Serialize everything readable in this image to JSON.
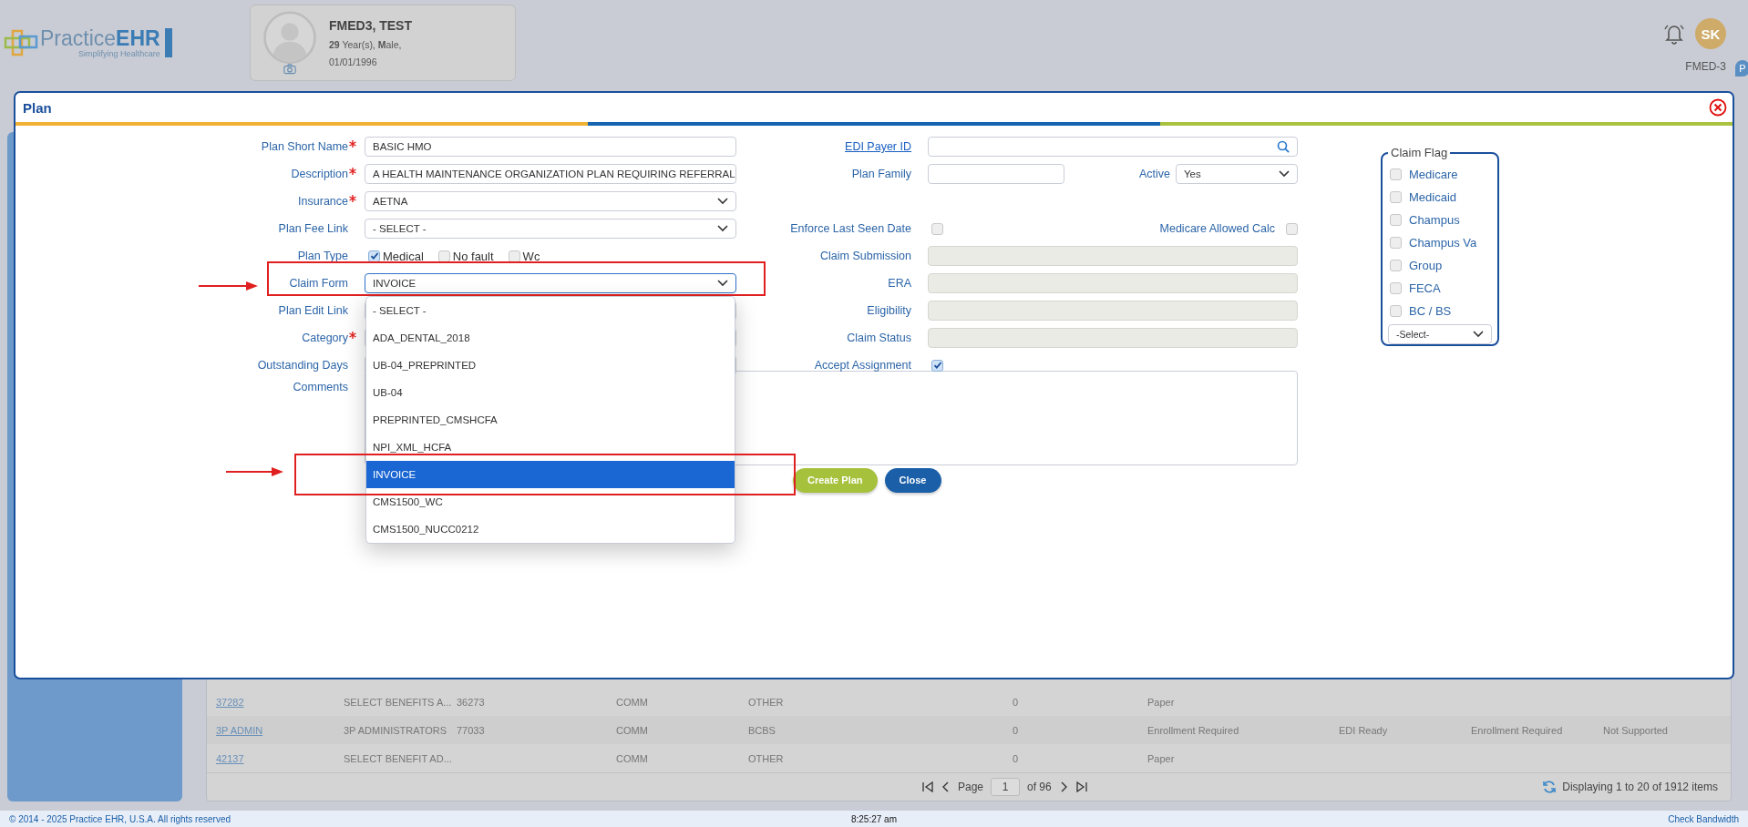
{
  "header": {
    "logo": {
      "word": "Practice",
      "word_bold": "EHR",
      "tagline": "Simplifying Healthcare"
    },
    "patient": {
      "name": "FMED3, TEST",
      "details": "**29** Year(s), **M**ale,",
      "dob": "01/01/1996"
    },
    "user": {
      "initials": "SK",
      "facility": "FMED-3",
      "pin_label": "P"
    }
  },
  "modal": {
    "title": "Plan",
    "rows": [
      {
        "left": {
          "label": "Plan Short Name",
          "required": true,
          "kind": "text",
          "value": "BASIC HMO"
        },
        "right": {
          "label": "EDI Payer ID",
          "label_link": true,
          "kind": "search"
        }
      },
      {
        "left": {
          "label": "Description",
          "required": true,
          "kind": "text",
          "value": "A HEALTH MAINTENANCE ORGANIZATION PLAN REQUIRING REFERRAL"
        },
        "right": {
          "label": "Plan Family",
          "kind": "text-select",
          "extra_label": "Active",
          "select_value": "Yes"
        }
      },
      {
        "left": {
          "label": "Insurance",
          "required": true,
          "kind": "select",
          "value": "AETNA"
        }
      },
      {
        "left": {
          "label": "Plan Fee Link",
          "kind": "select",
          "value": "- SELECT -"
        },
        "right": {
          "label": "Enforce Last Seen Date",
          "kind": "checkbox",
          "checked": false,
          "extra_label": "Medicare Allowed Calc",
          "extra_checked": false
        }
      },
      {
        "left": {
          "label": "Plan Type",
          "kind": "checkgroup",
          "options": [
            {
              "label": "Medical",
              "checked": true
            },
            {
              "label": "No fault",
              "checked": false
            },
            {
              "label": "Wc",
              "checked": false
            }
          ]
        },
        "right": {
          "label": "Claim Submission",
          "kind": "disabled"
        }
      },
      {
        "left": {
          "label": "Claim Form",
          "kind": "select",
          "value": "INVOICE",
          "open": true
        },
        "right": {
          "label": "ERA",
          "kind": "disabled"
        }
      },
      {
        "left": {
          "label": "Plan Edit Link",
          "kind": "text"
        },
        "right": {
          "label": "Eligibility",
          "kind": "disabled"
        }
      },
      {
        "left": {
          "label": "Category",
          "required": true,
          "kind": "text"
        },
        "right": {
          "label": "Claim Status",
          "kind": "disabled"
        }
      },
      {
        "left": {
          "label": "Outstanding Days",
          "kind": "text"
        },
        "right": {
          "label": "Accept Assignment",
          "kind": "checkbox",
          "checked": true
        }
      }
    ],
    "claim_form_options": [
      {
        "label": "- SELECT -",
        "selected": false
      },
      {
        "label": "ADA_DENTAL_2018",
        "selected": false
      },
      {
        "label": "UB-04_PREPRINTED",
        "selected": false
      },
      {
        "label": "UB-04",
        "selected": false
      },
      {
        "label": "PREPRINTED_CMSHCFA",
        "selected": false
      },
      {
        "label": "NPI_XML_HCFA",
        "selected": false
      },
      {
        "label": "INVOICE",
        "selected": true
      },
      {
        "label": "CMS1500_WC",
        "selected": false
      },
      {
        "label": "CMS1500_NUCC0212",
        "selected": false
      }
    ],
    "comments": {
      "label": "Comments"
    },
    "buttons": [
      {
        "label": "Create Plan",
        "kind": "primary"
      },
      {
        "label": "Close",
        "kind": "secondary"
      }
    ],
    "claim_flag": {
      "title": "Claim Flag",
      "options": [
        {
          "label": "Medicare",
          "checked": false
        },
        {
          "label": "Medicaid",
          "checked": false
        },
        {
          "label": "Champus",
          "checked": false
        },
        {
          "label": "Champus Va",
          "checked": false
        },
        {
          "label": "Group",
          "checked": false
        },
        {
          "label": "FECA",
          "checked": false
        },
        {
          "label": "BC / BS",
          "checked": false
        }
      ],
      "select_value": "-Select-"
    }
  },
  "table": {
    "rows": [
      {
        "cells": [
          "37282",
          "SELECT BENEFITS A...",
          "36273",
          "COMM",
          "OTHER",
          "0",
          "Paper",
          null,
          null,
          null
        ]
      },
      {
        "cells": [
          "3P ADMIN",
          "3P ADMINISTRATORS",
          "77033",
          "COMM",
          "BCBS",
          "0",
          "Enrollment Required",
          "EDI Ready",
          "Enrollment Required",
          "Not Supported"
        ]
      },
      {
        "cells": [
          "42137",
          "SELECT BENEFIT AD...",
          null,
          "COMM",
          "OTHER",
          "0",
          "Paper",
          null,
          null,
          null
        ]
      }
    ],
    "pager": {
      "page_label": "Page",
      "page": "1",
      "of": "of 96",
      "summary": "Displaying 1 to 20 of 1912 items"
    }
  },
  "footer": {
    "copyright": "© 2014 - 2025 Practice EHR, U.S.A. All rights reserved",
    "time": "8:25:27 am",
    "link": "Check Bandwidth"
  }
}
